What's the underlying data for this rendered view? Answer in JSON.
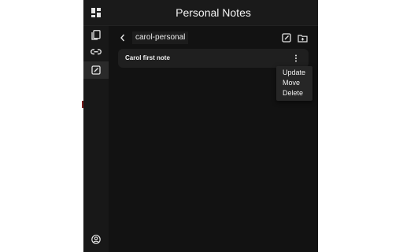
{
  "app": {
    "title": "Personal Notes"
  },
  "sidebar": {
    "items": [
      {
        "name": "notebooks",
        "icon": "notebook-icon",
        "active": false
      },
      {
        "name": "links",
        "icon": "link-icon",
        "active": false
      },
      {
        "name": "notes",
        "icon": "note-edit-icon",
        "active": true
      }
    ],
    "footer_icon": "account-icon"
  },
  "folder": {
    "name": "carol-personal",
    "actions": [
      {
        "label": "New note",
        "icon": "note-add-icon"
      },
      {
        "label": "New folder",
        "icon": "folder-add-icon"
      }
    ]
  },
  "notes": [
    {
      "title": "Carol first note"
    }
  ],
  "context_menu": {
    "items": [
      "Update",
      "Move",
      "Delete"
    ]
  },
  "colors": {
    "background": "#121212",
    "panel": "#1f1f1f",
    "text": "#f2f2f2",
    "menu": "#262626"
  }
}
